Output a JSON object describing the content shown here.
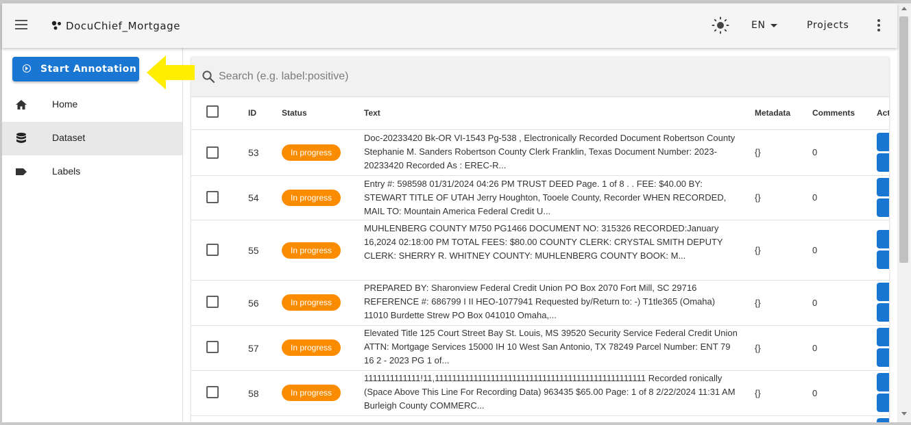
{
  "app": {
    "title": "DocuChief_Mortgage"
  },
  "header": {
    "language": "EN",
    "projects_label": "Projects"
  },
  "sidebar": {
    "start_button": "Start Annotation",
    "items": [
      {
        "label": "Home",
        "icon": "home-icon"
      },
      {
        "label": "Dataset",
        "icon": "database-icon",
        "active": true
      },
      {
        "label": "Labels",
        "icon": "label-icon"
      }
    ]
  },
  "search": {
    "placeholder": "Search (e.g. label:positive)"
  },
  "table": {
    "columns": [
      "ID",
      "Status",
      "Text",
      "Metadata",
      "Comments",
      "Act"
    ],
    "rows": [
      {
        "id": "53",
        "status": "In progress",
        "text": "Doc-20233420 Bk-OR VI-1543 Pg-538 , Electronically Recorded Document Robertson County Stephanie M. Sanders Robertson County Clerk Franklin, Texas Document Number: 2023-20233420 Recorded As : EREC-R...",
        "metadata": "{}",
        "comments": "0"
      },
      {
        "id": "54",
        "status": "In progress",
        "text": "Entry #: 598598 01/31/2024 04:26 PM TRUST DEED Page. 1 of 8 . . FEE: $40.00 BY: STEWART TITLE OF UTAH Jerry Houghton, Tooele County, Recorder WHEN RECORDED, MAIL TO: Mountain America Federal Credit U...",
        "metadata": "{}",
        "comments": "0"
      },
      {
        "id": "55",
        "status": "In progress",
        "text": "MUHLENBERG COUNTY M750 PG1466 DOCUMENT NO: 315326 RECORDED:January 16,2024 02:18:00 PM TOTAL FEES: $80.00 COUNTY CLERK: CRYSTAL SMITH DEPUTY CLERK: SHERRY R. WHITNEY COUNTY: MUHLENBERG COUNTY BOOK: M...",
        "metadata": "{}",
        "comments": "0"
      },
      {
        "id": "56",
        "status": "In progress",
        "text": "PREPARED BY: Sharonview Federal Credit Union PO Box 2070 Fort Mill, SC 29716 REFERENCE #: 686799 I II HEO-1077941 Requested by/Return to: -) T1tle365 (Omaha) 11010 Burdette Strew PO Box 041010 Omaha,...",
        "metadata": "{}",
        "comments": "0"
      },
      {
        "id": "57",
        "status": "In progress",
        "text": "Elevated Title 125 Court Street Bay St. Louis, MS 39520 Security Service Federal Credit Union ATTN: Mortgage Services 15000 IH 10 West San Antonio, TX 78249 Parcel Number: ENT 79 16 2 - 2023 PG 1 of...",
        "metadata": "{}",
        "comments": "0"
      },
      {
        "id": "58",
        "status": "In progress",
        "text": "1111111111111!11,1111111111111111111111111111111111111111111111111 Recorded ronically (Space Above This Line For Recording Data) 963435 $65.00 Page: 1 of 8 2/22/2024 11:31 AM Burleigh County COMMERC...",
        "metadata": "{}",
        "comments": "0"
      }
    ]
  },
  "colors": {
    "primary": "#1976d2",
    "status_in_progress": "#fb8c00",
    "arrow": "#ffee00"
  }
}
